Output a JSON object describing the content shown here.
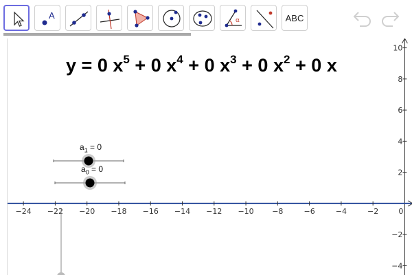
{
  "toolbar": {
    "tools": [
      {
        "name": "move-tool",
        "icon": "arrow-cursor-icon",
        "selected": true
      },
      {
        "name": "point-tool",
        "icon": "point-icon",
        "label": "A"
      },
      {
        "name": "line-tool",
        "icon": "line-through-points-icon"
      },
      {
        "name": "perpendicular-tool",
        "icon": "perpendicular-line-icon"
      },
      {
        "name": "polygon-tool",
        "icon": "polygon-icon"
      },
      {
        "name": "circle-tool",
        "icon": "circle-center-point-icon"
      },
      {
        "name": "conic-tool",
        "icon": "ellipse-icon"
      },
      {
        "name": "angle-tool",
        "icon": "angle-icon",
        "label": "α"
      },
      {
        "name": "reflect-tool",
        "icon": "reflect-point-icon"
      },
      {
        "name": "text-tool",
        "icon": "text-icon",
        "label": "ABC"
      }
    ],
    "undo_icon": "undo-icon",
    "redo_icon": "redo-icon",
    "progress_fraction": 0.455,
    "accent": "#6b6be0"
  },
  "equation": {
    "y": "y",
    "equals": "=",
    "terms": [
      {
        "coef": "0",
        "var": "x",
        "exp": "5"
      },
      {
        "coef": "0",
        "var": "x",
        "exp": "4"
      },
      {
        "coef": "0",
        "var": "x",
        "exp": "3"
      },
      {
        "coef": "0",
        "var": "x",
        "exp": "2"
      },
      {
        "coef": "0",
        "var": "x",
        "exp": ""
      }
    ],
    "plus": "+"
  },
  "sliders": [
    {
      "name": "a",
      "sub": "1",
      "value_text": "= 0"
    },
    {
      "name": "a",
      "sub": "0",
      "value_text": "= 0"
    }
  ],
  "axes": {
    "x_ticks": [
      "−24",
      "−22",
      "−20",
      "−18",
      "−16",
      "−14",
      "−12",
      "−10",
      "−8",
      "−6",
      "−4",
      "−2",
      "0"
    ],
    "y_ticks": [
      "10",
      "8",
      "6",
      "4",
      "2",
      "−2",
      "−4"
    ],
    "x_range": [
      -25,
      0.5
    ],
    "y_range": [
      -4.6,
      10.6
    ],
    "axis_color": "#2a4b9b"
  }
}
